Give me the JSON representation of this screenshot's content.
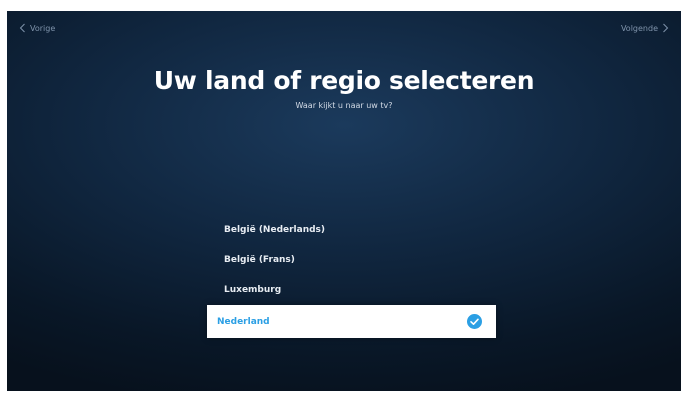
{
  "nav": {
    "prev_label": "Vorige",
    "next_label": "Volgende"
  },
  "header": {
    "title": "Uw land of regio selecteren",
    "subtitle": "Waar kijkt u naar uw tv?"
  },
  "countries": {
    "items": [
      {
        "label": "België (Nederlands)",
        "selected": false
      },
      {
        "label": "België (Frans)",
        "selected": false
      },
      {
        "label": "Luxemburg",
        "selected": false
      },
      {
        "label": "Nederland",
        "selected": true
      }
    ]
  },
  "colors": {
    "accent": "#2b9fe4",
    "background": "#10263f",
    "selected_bg": "#ffffff"
  },
  "icons": {
    "prev": "chevron-left-icon",
    "next": "chevron-right-icon",
    "selected": "check-circle-icon"
  }
}
